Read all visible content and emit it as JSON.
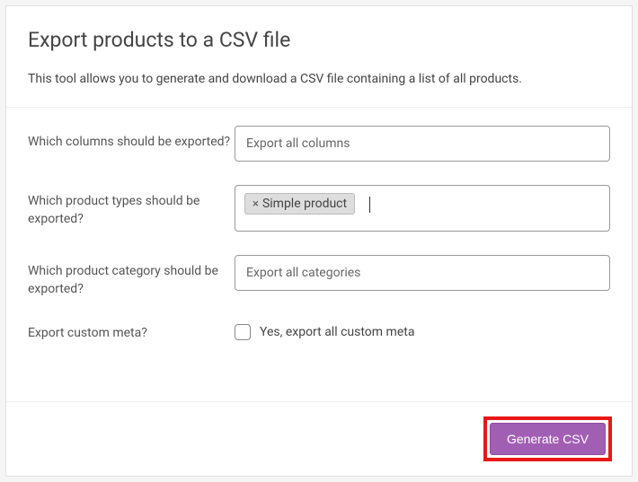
{
  "header": {
    "title": "Export products to a CSV file",
    "description": "This tool allows you to generate and download a CSV file containing a list of all products."
  },
  "form": {
    "columns": {
      "label": "Which columns should be exported?",
      "placeholder": "Export all columns"
    },
    "product_types": {
      "label": "Which product types should be exported?",
      "tags": [
        {
          "label": "Simple product"
        }
      ]
    },
    "categories": {
      "label": "Which product category should be exported?",
      "placeholder": "Export all categories"
    },
    "custom_meta": {
      "label": "Export custom meta?",
      "checkbox_label": "Yes, export all custom meta"
    }
  },
  "footer": {
    "generate_label": "Generate CSV"
  }
}
